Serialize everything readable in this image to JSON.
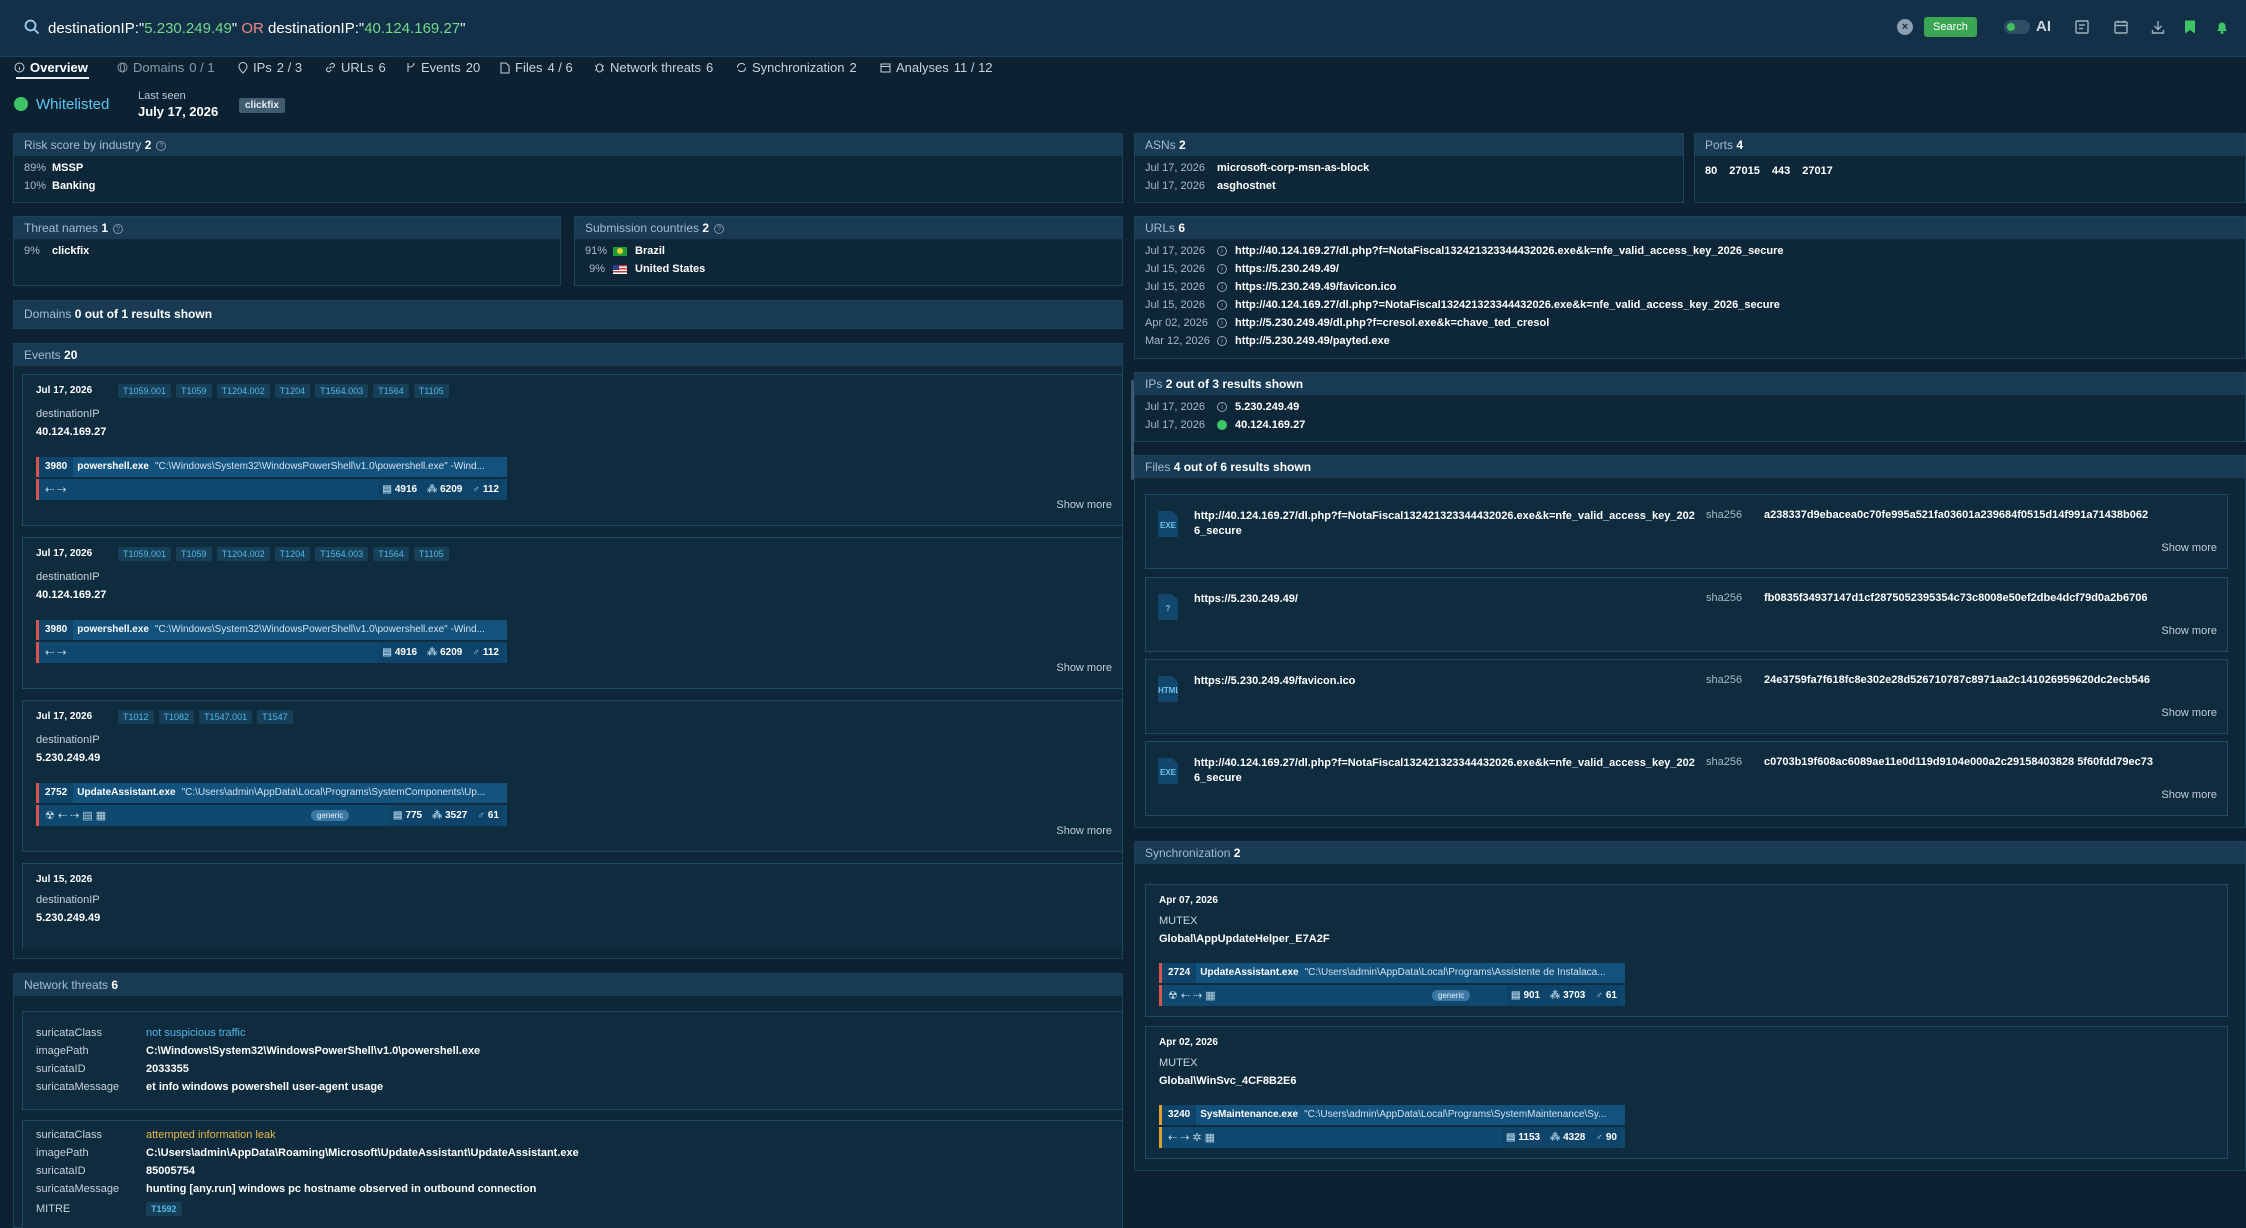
{
  "search": {
    "q1_key": "destinationIP:\"",
    "q1_val": "5.230.249.49",
    "q1_end": "\"",
    "op": "OR",
    "q2_key": "destinationIP:\"",
    "q2_val": "40.124.169.27",
    "q2_end": "\"",
    "button": "Search",
    "ai": "AI"
  },
  "tabs": [
    {
      "label": "Overview",
      "count": ""
    },
    {
      "label": "Domains",
      "count": "0 / 1"
    },
    {
      "label": "IPs",
      "count": "2 / 3"
    },
    {
      "label": "URLs",
      "count": "6"
    },
    {
      "label": "Events",
      "count": "20"
    },
    {
      "label": "Files",
      "count": "4 / 6"
    },
    {
      "label": "Network threats",
      "count": "6"
    },
    {
      "label": "Synchronization",
      "count": "2"
    },
    {
      "label": "Analyses",
      "count": "11 / 12"
    }
  ],
  "status": {
    "verdict": "Whitelisted",
    "last_seen_label": "Last seen",
    "last_seen": "July 17, 2026",
    "tag": "clickfix"
  },
  "risk": {
    "title": "Risk score by industry",
    "count": "2",
    "rows": [
      {
        "pct": "89%",
        "name": "MSSP"
      },
      {
        "pct": "10%",
        "name": "Banking"
      }
    ]
  },
  "asns": {
    "title": "ASNs",
    "count": "2",
    "rows": [
      {
        "date": "Jul 17, 2026",
        "name": "microsoft-corp-msn-as-block"
      },
      {
        "date": "Jul 17, 2026",
        "name": "asghostnet"
      }
    ]
  },
  "ports": {
    "title": "Ports",
    "count": "4",
    "items": [
      "80",
      "27015",
      "443",
      "27017"
    ]
  },
  "threat_names": {
    "title": "Threat names",
    "count": "1",
    "rows": [
      {
        "pct": "9%",
        "name": "clickfix"
      }
    ]
  },
  "countries": {
    "title": "Submission countries",
    "count": "2",
    "rows": [
      {
        "pct": "91%",
        "name": "Brazil",
        "flag": "flag-br"
      },
      {
        "pct": "9%",
        "name": "United States",
        "flag": "flag-us"
      }
    ]
  },
  "urls": {
    "title": "URLs",
    "count": "6",
    "rows": [
      {
        "date": "Jul 17, 2026",
        "url": "http://40.124.169.27/dl.php?f=NotaFiscal132421323344432026.exe&k=nfe_valid_access_key_2026_secure"
      },
      {
        "date": "Jul 15, 2026",
        "url": "https://5.230.249.49/"
      },
      {
        "date": "Jul 15, 2026",
        "url": "https://5.230.249.49/favicon.ico"
      },
      {
        "date": "Jul 15, 2026",
        "url": "http://40.124.169.27/dl.php?=NotaFiscal132421323344432026.exe&k=nfe_valid_access_key_2026_secure"
      },
      {
        "date": "Apr 02, 2026",
        "url": "http://5.230.249.49/dl.php?f=cresol.exe&k=chave_ted_cresol"
      },
      {
        "date": "Mar 12, 2026",
        "url": "http://5.230.249.49/payted.exe"
      }
    ]
  },
  "ips": {
    "title": "IPs",
    "count": "2 out of 3 results shown",
    "rows": [
      {
        "date": "Jul 17, 2026",
        "ip": "5.230.249.49",
        "icon": "info"
      },
      {
        "date": "Jul 17, 2026",
        "ip": "40.124.169.27",
        "icon": "ok"
      }
    ]
  },
  "domains": {
    "title": "Domains",
    "count": "0 out of 1 results shown"
  },
  "events": {
    "title": "Events",
    "count": "20",
    "show_more": "Show more",
    "items": [
      {
        "date": "Jul 17, 2026",
        "tags": [
          "T1059.001",
          "T1059",
          "T1204.002",
          "T1204",
          "T1564.003",
          "T1564",
          "T1105"
        ],
        "label": "destinationIP",
        "value": "40.124.169.27",
        "pid": "3980",
        "pname": "powershell.exe",
        "cmd": "\"C:\\Windows\\System32\\WindowsPowerShell\\v1.0\\powershell.exe\" -Wind...",
        "icons": "⇠⇢",
        "generic": "",
        "s1": "4916",
        "s2": "6209",
        "s3": "112"
      },
      {
        "date": "Jul 17, 2026",
        "tags": [
          "T1059.001",
          "T1059",
          "T1204.002",
          "T1204",
          "T1564.003",
          "T1564",
          "T1105"
        ],
        "label": "destinationIP",
        "value": "40.124.169.27",
        "pid": "3980",
        "pname": "powershell.exe",
        "cmd": "\"C:\\Windows\\System32\\WindowsPowerShell\\v1.0\\powershell.exe\" -Wind...",
        "icons": "⇠⇢",
        "generic": "",
        "s1": "4916",
        "s2": "6209",
        "s3": "112"
      },
      {
        "date": "Jul 17, 2026",
        "tags": [
          "T1012",
          "T1082",
          "T1547.001",
          "T1547"
        ],
        "label": "destinationIP",
        "value": "5.230.249.49",
        "pid": "2752",
        "pname": "UpdateAssistant.exe",
        "cmd": "\"C:\\Users\\admin\\AppData\\Local\\Programs\\SystemComponents\\Up...",
        "icons": "☢⇠⇢▤▦",
        "generic": "generic",
        "s1": "775",
        "s2": "3527",
        "s3": "61"
      },
      {
        "date": "Jul 15, 2026",
        "tags": [],
        "label": "destinationIP",
        "value": "5.230.249.49"
      }
    ]
  },
  "network": {
    "title": "Network threats",
    "count": "6",
    "items": [
      {
        "class_label": "suricataClass",
        "class": "not suspicious traffic",
        "class_color": "blue",
        "path_label": "imagePath",
        "path": "C:\\Windows\\System32\\WindowsPowerShell\\v1.0\\powershell.exe",
        "id_label": "suricataID",
        "id": "2033355",
        "msg_label": "suricataMessage",
        "msg": "et info windows powershell user-agent usage"
      },
      {
        "class_label": "suricataClass",
        "class": "attempted information leak",
        "class_color": "gold",
        "path_label": "imagePath",
        "path": "C:\\Users\\admin\\AppData\\Roaming\\Microsoft\\UpdateAssistant\\UpdateAssistant.exe",
        "id_label": "suricataID",
        "id": "85005754",
        "msg_label": "suricataMessage",
        "msg": "hunting [any.run] windows pc hostname observed in outbound connection",
        "mitre_label": "MITRE",
        "mitre": "T1592"
      }
    ]
  },
  "files": {
    "title": "Files",
    "count": "4 out of 6 results shown",
    "sha_label": "sha256",
    "show_more": "Show more",
    "items": [
      {
        "type": "EXE",
        "url": "http://40.124.169.27/dl.php?f=NotaFiscal132421323344432026.exe&k=nfe_valid_access_key_2026_secure",
        "sha": "a238337d9ebacea0c70fe995a521fa03601a239684f0515d14f991a71438b062"
      },
      {
        "type": "?",
        "url": "https://5.230.249.49/",
        "sha": "fb0835f34937147d1cf2875052395354c73c8008e50ef2dbe4dcf79d0a2b6706"
      },
      {
        "type": "HTML",
        "url": "https://5.230.249.49/favicon.ico",
        "sha": "24e3759fa7f618fc8e302e28d526710787c8971aa2c141026959620dc2ecb546"
      },
      {
        "type": "EXE",
        "url": "http://40.124.169.27/dl.php?f=NotaFiscal132421323344432026.exe&k=nfe_valid_access_key_2026_secure",
        "sha": "c0703b19f608ac6089ae11e0d119d9104e000a2c29158403828 5f60fdd79ec73"
      }
    ]
  },
  "sync": {
    "title": "Synchronization",
    "count": "2",
    "items": [
      {
        "date": "Apr 07, 2026",
        "type": "MUTEX",
        "name": "Global\\AppUpdateHelper_E7A2F",
        "pid": "2724",
        "pname": "UpdateAssistant.exe",
        "cmd": "\"C:\\Users\\admin\\AppData\\Local\\Programs\\Assistente de Instalaca...",
        "icons": "☢⇠⇢▦",
        "generic": "generic",
        "s1": "901",
        "s2": "3703",
        "s3": "61",
        "color": "#d9534f"
      },
      {
        "date": "Apr 02, 2026",
        "type": "MUTEX",
        "name": "Global\\WinSvc_4CF8B2E6",
        "pid": "3240",
        "pname": "SysMaintenance.exe",
        "cmd": "\"C:\\Users\\admin\\AppData\\Local\\Programs\\SystemMaintenance\\Sy...",
        "icons": "⇠⇢✲▦",
        "generic": "",
        "s1": "1153",
        "s2": "4328",
        "s3": "90",
        "color": "#e0a030"
      }
    ]
  }
}
